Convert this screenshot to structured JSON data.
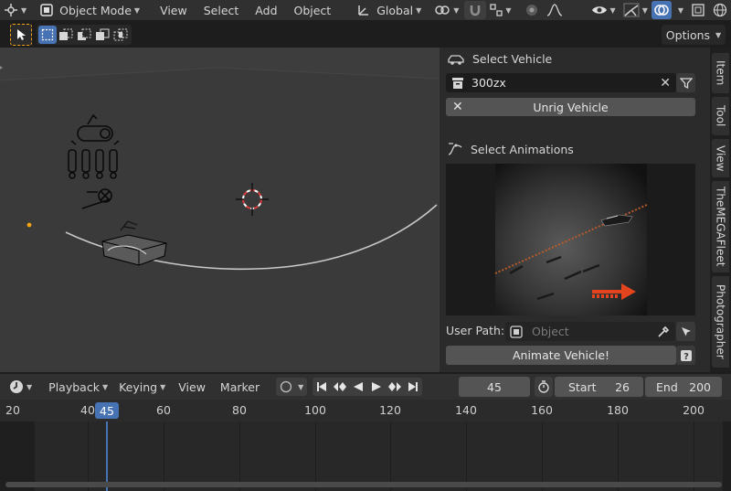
{
  "header": {
    "mode_label": "Object Mode",
    "menus": [
      "View",
      "Select",
      "Add",
      "Object"
    ],
    "transform_orientation": "Global"
  },
  "toolbar": {
    "options_label": "Options"
  },
  "npanel": {
    "vehicle_section_title": "Select Vehicle",
    "vehicle_value": "300zx",
    "unrig_label": "Unrig Vehicle",
    "animations_section_title": "Select Animations",
    "user_path_label": "User Path:",
    "user_path_placeholder": "Object",
    "animate_label": "Animate Vehicle!"
  },
  "sidebar_tabs": [
    "Item",
    "Tool",
    "View",
    "TheMEGAFleet",
    "Photographer"
  ],
  "timeline": {
    "menus": [
      "Playback",
      "Keying",
      "View",
      "Marker"
    ],
    "current_frame": "45",
    "start_label": "Start",
    "start_value": "26",
    "end_label": "End",
    "end_value": "200",
    "ruler_ticks": [
      "20",
      "40",
      "60",
      "80",
      "100",
      "120",
      "140",
      "160",
      "180",
      "200"
    ],
    "playhead_label": "45"
  },
  "colors": {
    "accent": "#4772b3",
    "playhead": "#4772b3",
    "selection": "#f5a30f",
    "cursor_red": "#e23b3b"
  }
}
